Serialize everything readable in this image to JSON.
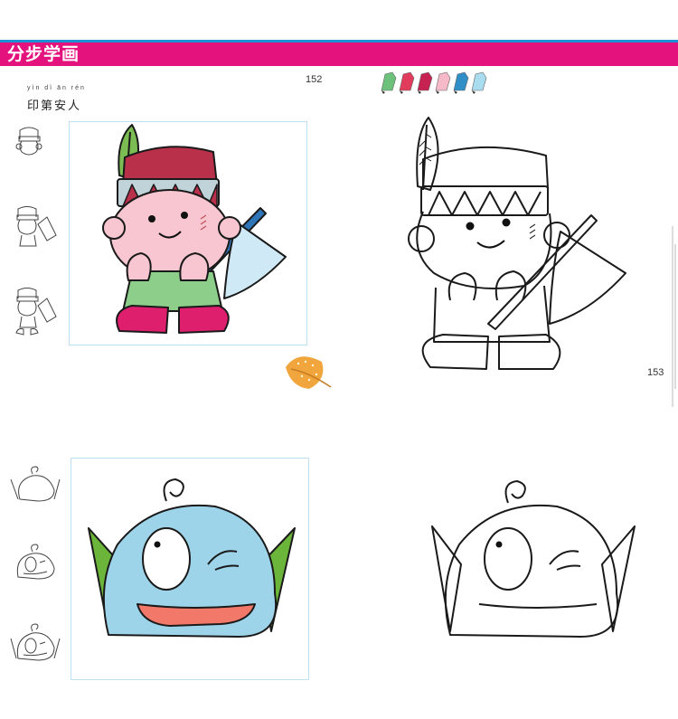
{
  "header": {
    "title": "分步学画"
  },
  "pages": {
    "left_number": "152",
    "right_number": "153"
  },
  "lesson1": {
    "pinyin": "yìn  dì  ān  rén",
    "title": "印第安人"
  },
  "colors": {
    "banner": "#e4127c",
    "accent_line": "#1e90d6",
    "skin": "#f7c6d0",
    "hat": "#b8304a",
    "feather": "#7bbd52",
    "shirt": "#8dcf8a",
    "boots": "#dd1f6e",
    "axe_blade": "#cfeaf6",
    "axe_handle": "#2f76b8",
    "fish_body": "#9ed4ea",
    "fish_fins": "#6ab53a",
    "fish_mouth": "#f2786a",
    "leaf": "#f0a63c"
  },
  "icons": [
    "pencil-green",
    "pencil-red",
    "pencil-red-2",
    "pencil-pink",
    "pencil-blue",
    "pencil-lightblue",
    "leaf-icon"
  ]
}
